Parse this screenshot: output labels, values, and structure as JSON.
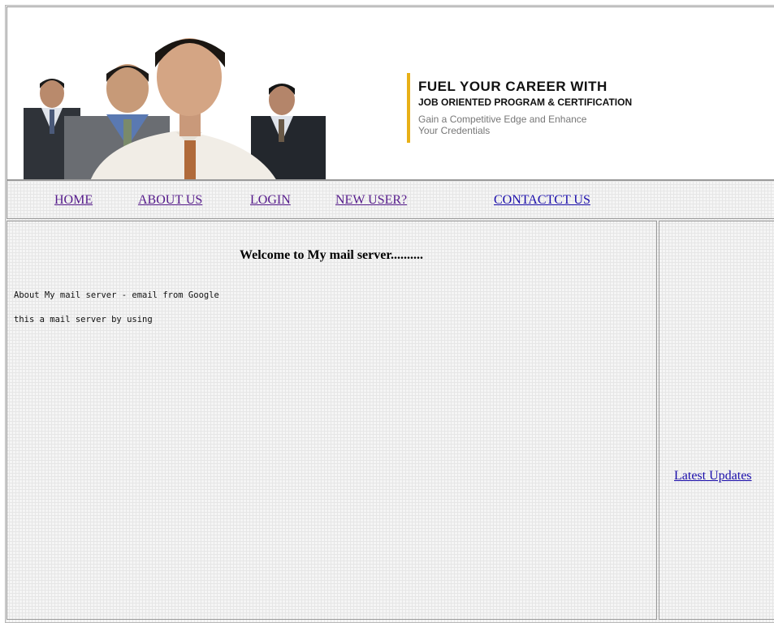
{
  "banner": {
    "headline": "FUEL YOUR CAREER WITH",
    "subheadline": "JOB ORIENTED PROGRAM & CERTIFICATION",
    "tagline_line1": "Gain a Competitive Edge and Enhance",
    "tagline_line2": "Your Credentials",
    "accent_color": "#e8b017",
    "image": "group-of-businessmen-photo"
  },
  "nav": {
    "items": [
      {
        "label": "HOME"
      },
      {
        "label": "ABOUT US"
      },
      {
        "label": "LOGIN"
      },
      {
        "label": "NEW USER?"
      },
      {
        "label": "CONTACTCT US"
      }
    ]
  },
  "main": {
    "welcome": "Welcome to My mail server..........",
    "line1": "About My mail server - email from Google",
    "line2": "this a mail server by using"
  },
  "sidebar": {
    "latest_updates": "Latest Updates"
  }
}
